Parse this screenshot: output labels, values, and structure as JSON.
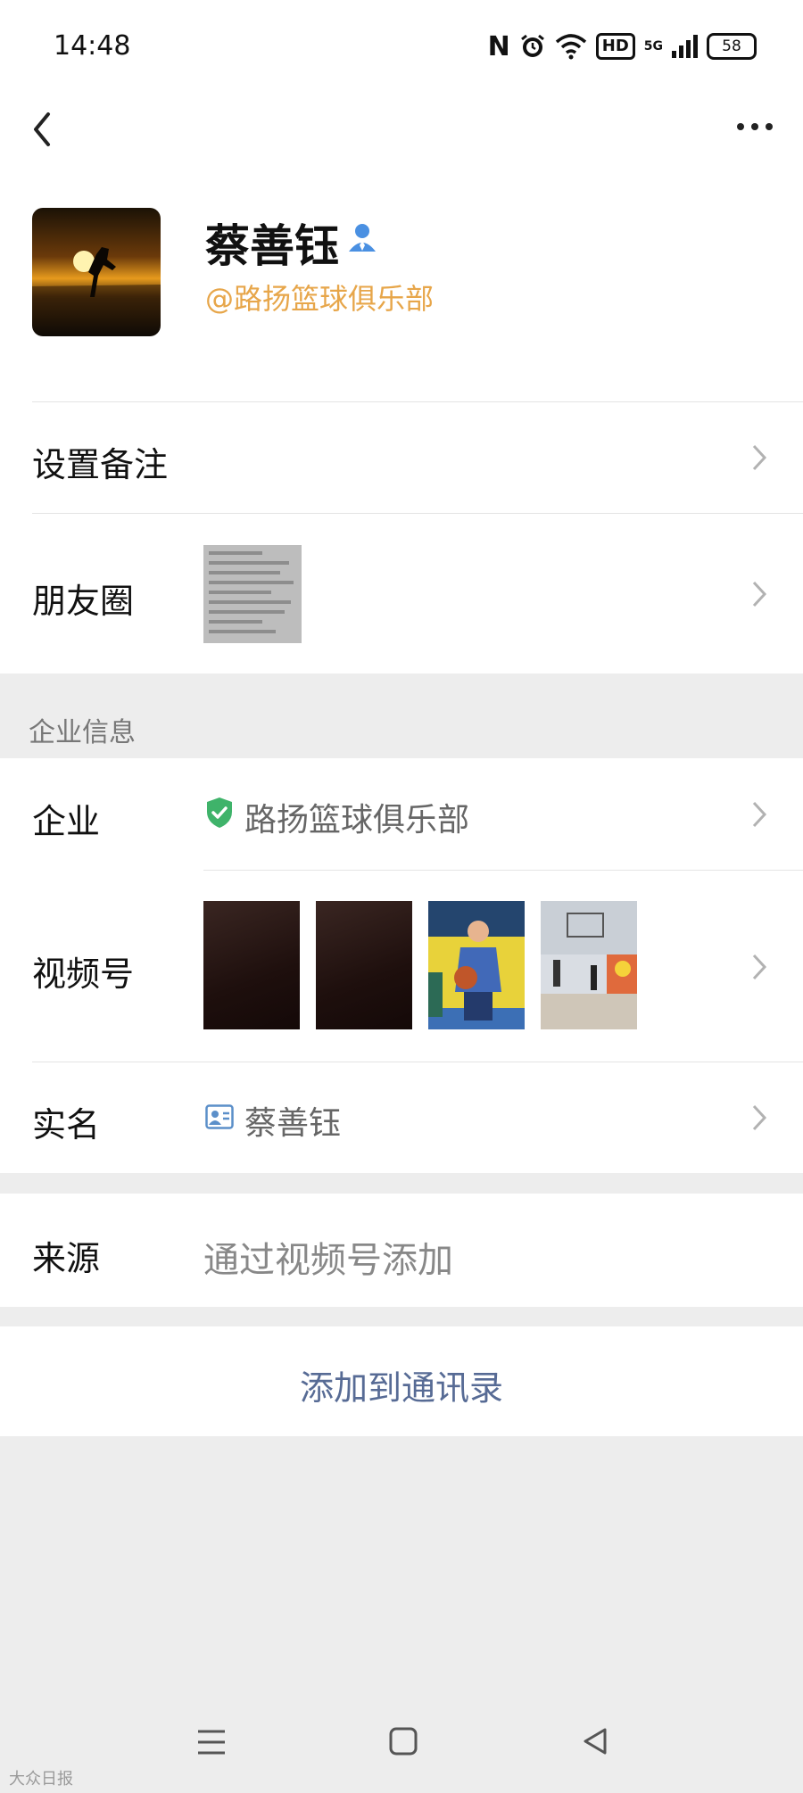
{
  "status_bar": {
    "time": "14:48",
    "nfc": "N",
    "hd": "HD",
    "network": "5G",
    "battery": "58"
  },
  "profile": {
    "name": "蔡善钰",
    "corp_tag": "@路扬篮球俱乐部"
  },
  "rows": {
    "remark_label": "设置备注",
    "moments_label": "朋友圈"
  },
  "enterprise_section": {
    "title": "企业信息",
    "company_label": "企业",
    "company_value": "路扬篮球俱乐部",
    "channels_label": "视频号",
    "realname_label": "实名",
    "realname_value": "蔡善钰"
  },
  "source": {
    "label": "来源",
    "value": "通过视频号添加"
  },
  "actions": {
    "add_contact": "添加到通讯录"
  },
  "watermark": "大众日报",
  "colors": {
    "corp_tag": "#e7a64a",
    "link": "#576b95",
    "verified_shield": "#3fb36a",
    "background": "#ededed"
  },
  "icons": [
    "back-arrow-icon",
    "more-icon",
    "person-verified-icon",
    "chevron-right-icon",
    "shield-check-icon",
    "id-card-icon",
    "menu-icon",
    "home-icon",
    "back-triangle-icon"
  ]
}
